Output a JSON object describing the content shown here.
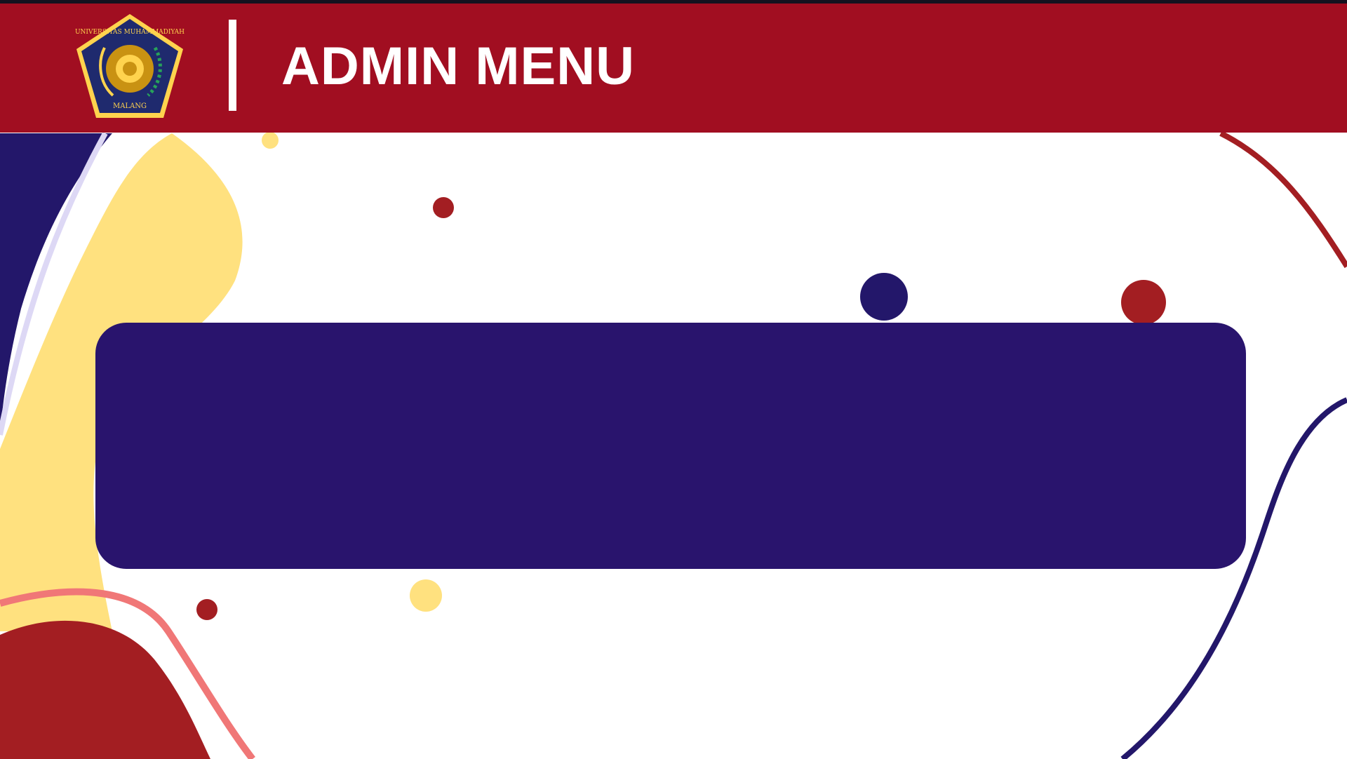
{
  "header": {
    "title": "ADMIN MENU",
    "logo": {
      "icon": "university-crest-icon",
      "text_top": "UNIVERSITAS MUHAMMADIYAH",
      "text_bottom": "MALANG"
    }
  },
  "colors": {
    "header_background": "#a10e21",
    "panel_background": "#29146d",
    "accent_yellow": "#ffe17f",
    "accent_red": "#a31e22",
    "accent_pink": "#f07777",
    "accent_navy": "#23176a"
  }
}
